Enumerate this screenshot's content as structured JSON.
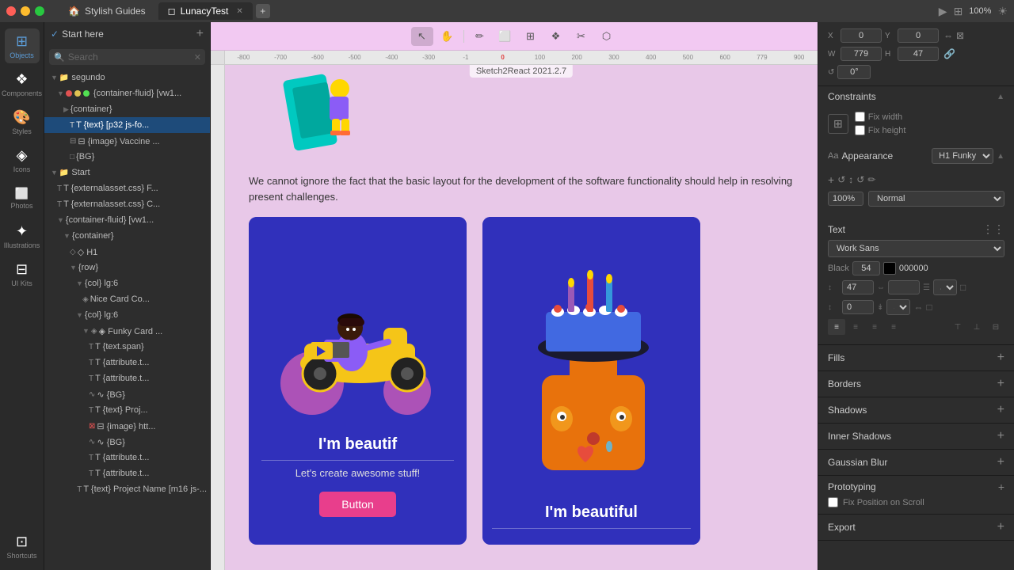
{
  "titlebar": {
    "tabs": [
      {
        "id": "stylish",
        "label": "Stylish Guides",
        "icon": "🏠",
        "active": false
      },
      {
        "id": "lunacy",
        "label": "LunacyTest",
        "icon": "◻",
        "active": true
      }
    ],
    "add_tab": "+",
    "app_title": "Sketch2React 2021.2.7"
  },
  "sidebar_icons": [
    {
      "id": "objects",
      "symbol": "⊞",
      "label": "Objects",
      "active": true
    },
    {
      "id": "components",
      "symbol": "❖",
      "label": "Components",
      "active": false
    },
    {
      "id": "styles",
      "symbol": "🎨",
      "label": "Styles",
      "active": false
    },
    {
      "id": "icons",
      "symbol": "◈",
      "label": "Icons",
      "active": false
    },
    {
      "id": "photos",
      "symbol": "⬜",
      "label": "Photos",
      "active": false
    },
    {
      "id": "illustrations",
      "symbol": "✦",
      "label": "Illustrations",
      "active": false
    },
    {
      "id": "ui-kits",
      "symbol": "⊟",
      "label": "UI Kits",
      "active": false
    },
    {
      "id": "shortcuts",
      "symbol": "⊡",
      "label": "Shortcuts",
      "active": false
    }
  ],
  "left_panel": {
    "start_here": "Start here",
    "search_placeholder": "Search",
    "tree": [
      {
        "id": 1,
        "level": 0,
        "type": "folder",
        "label": "segundo",
        "expanded": true,
        "icon": "folder"
      },
      {
        "id": 2,
        "level": 1,
        "type": "folder-code",
        "label": "{container-fluid} [vw1...",
        "expanded": true,
        "icon": "code-folder",
        "badges": [
          "red",
          "yellow",
          "green"
        ]
      },
      {
        "id": 3,
        "level": 2,
        "type": "folder",
        "label": "{container}",
        "expanded": false,
        "icon": "folder"
      },
      {
        "id": 4,
        "level": 3,
        "type": "text",
        "label": "T  {text} [p32 js-fo...",
        "selected": true
      },
      {
        "id": 5,
        "level": 3,
        "type": "image",
        "label": "⊟ {image} Vaccine ...",
        "icon": "image"
      },
      {
        "id": 6,
        "level": 3,
        "type": "rect",
        "label": "{BG}",
        "icon": "rect"
      },
      {
        "id": 7,
        "level": 0,
        "type": "folder",
        "label": "Start",
        "expanded": true,
        "icon": "folder"
      },
      {
        "id": 8,
        "level": 1,
        "type": "text",
        "label": "T  {externalasset.css} F..."
      },
      {
        "id": 9,
        "level": 1,
        "type": "text",
        "label": "T  {externalasset.css} C..."
      },
      {
        "id": 10,
        "level": 1,
        "type": "folder-code",
        "label": "{container-fluid} [vw1...",
        "expanded": true,
        "icon": "code-folder"
      },
      {
        "id": 11,
        "level": 2,
        "type": "folder",
        "label": "{container}",
        "expanded": true,
        "icon": "folder"
      },
      {
        "id": 12,
        "level": 3,
        "type": "heading",
        "label": "◇ H1",
        "icon": "heading"
      },
      {
        "id": 13,
        "level": 3,
        "type": "folder",
        "label": "{row}",
        "expanded": true,
        "icon": "folder"
      },
      {
        "id": 14,
        "level": 4,
        "type": "folder",
        "label": "{col} lg:6",
        "expanded": true,
        "icon": "folder"
      },
      {
        "id": 15,
        "level": 5,
        "type": "card",
        "label": "Nice Card Co...",
        "icon": "card"
      },
      {
        "id": 16,
        "level": 4,
        "type": "folder",
        "label": "{col} lg:6",
        "expanded": true,
        "icon": "folder"
      },
      {
        "id": 17,
        "level": 5,
        "type": "card",
        "label": "◈ Funky Card ...",
        "expanded": true,
        "icon": "card"
      },
      {
        "id": 18,
        "level": 6,
        "type": "text",
        "label": "T  {text.span}"
      },
      {
        "id": 19,
        "level": 6,
        "type": "text",
        "label": "T  {attribute.t..."
      },
      {
        "id": 20,
        "level": 6,
        "type": "text",
        "label": "T  {attribute.t..."
      },
      {
        "id": 21,
        "level": 6,
        "type": "bg",
        "label": "∿ {BG}"
      },
      {
        "id": 22,
        "level": 6,
        "type": "text",
        "label": "T  {text} Proj..."
      },
      {
        "id": 23,
        "level": 6,
        "type": "image",
        "label": "⊟ {image} htt..."
      },
      {
        "id": 24,
        "level": 6,
        "type": "bg",
        "label": "∿ {BG}"
      },
      {
        "id": 25,
        "level": 6,
        "type": "text",
        "label": "T  {attribute.t..."
      },
      {
        "id": 26,
        "level": 6,
        "type": "text",
        "label": "T  {attribute.t..."
      },
      {
        "id": 27,
        "level": 6,
        "type": "text",
        "label": "T  {text} Project Name [m16 js-..."
      }
    ]
  },
  "canvas": {
    "ruler_marks": [
      "-800",
      "-700",
      "-600",
      "-500",
      "-400",
      "-300",
      "-1",
      "0",
      "100",
      "200",
      "300",
      "400",
      "500",
      "600",
      "779",
      "900"
    ],
    "app_label": "Sketch2React 2021.2.7",
    "content_text": "We cannot ignore the fact that the basic layout for the development of the software functionality should help in resolving present challenges.",
    "card1": {
      "title": "I'm beautif",
      "subtitle": "Let's create awesome stuff!",
      "button_label": "Button"
    },
    "card2": {
      "title": "I'm beautiful"
    }
  },
  "right_panel": {
    "x": {
      "label": "X",
      "value": "0"
    },
    "y": {
      "label": "Y",
      "value": "0"
    },
    "w": {
      "label": "W",
      "value": "779"
    },
    "h": {
      "label": "H",
      "value": "47"
    },
    "rotation": "0°",
    "constraints": {
      "title": "Constraints",
      "fix_width": "Fix width",
      "fix_height": "Fix height"
    },
    "appearance": {
      "title": "Appearance",
      "font_name": "H1 Funky",
      "tools": [
        "↺",
        "↺",
        "↕",
        "↺"
      ],
      "opacity": "100%",
      "blend": "Normal"
    },
    "text": {
      "title": "Text",
      "font_family": "Work Sans",
      "color_label": "Black",
      "color_value": "54",
      "color_hex": "000000",
      "size_value": "47",
      "offset_value": "0",
      "align_options": [
        "left",
        "center",
        "right",
        "justify"
      ]
    },
    "fills": {
      "title": "Fills"
    },
    "borders": {
      "title": "Borders"
    },
    "shadows": {
      "title": "Shadows"
    },
    "inner_shadows": {
      "title": "Inner Shadows"
    },
    "gaussian_blur": {
      "title": "Gaussian Blur"
    },
    "prototyping": {
      "title": "Prototyping",
      "fix_scroll": "Fix Position on Scroll"
    },
    "export": {
      "title": "Export"
    }
  }
}
